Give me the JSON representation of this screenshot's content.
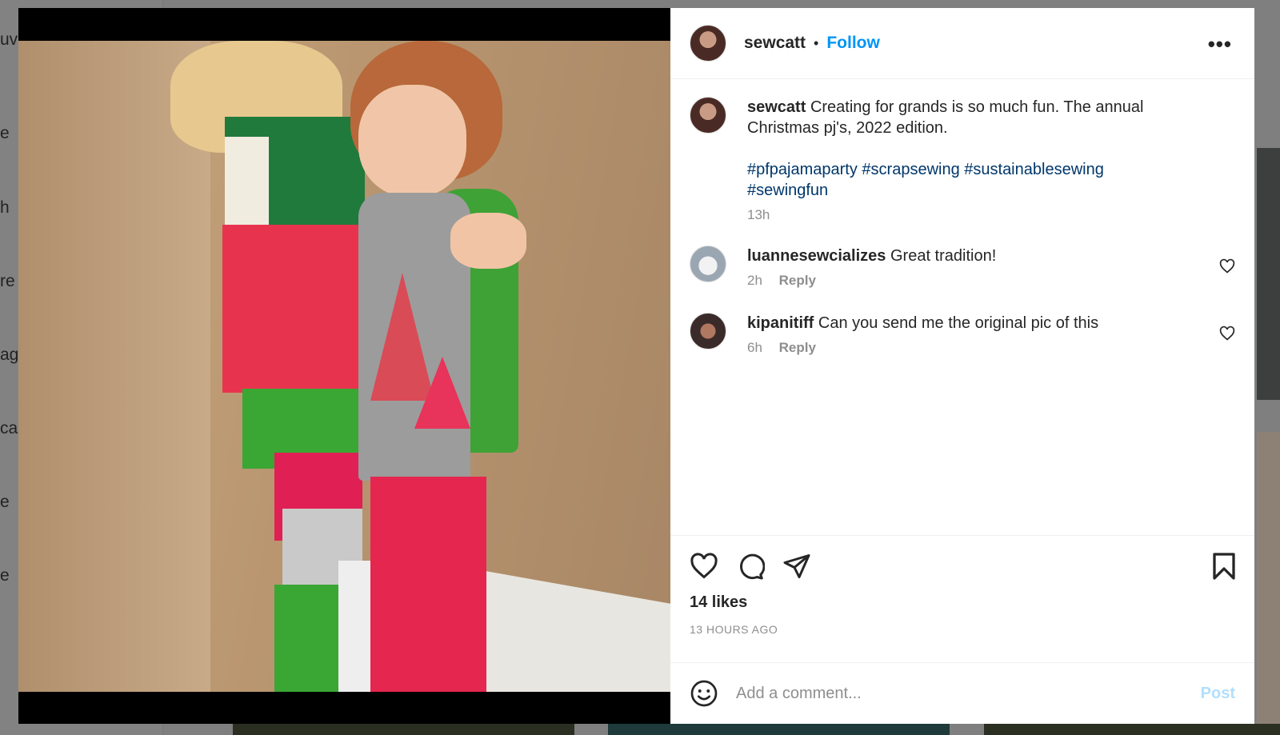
{
  "background": {
    "nav_letters": [
      "uv",
      "e",
      "h",
      "re",
      "ag",
      "ca",
      "e",
      "e"
    ]
  },
  "post": {
    "author": "sewcatt",
    "follow_label": "Follow",
    "more_label": "•••",
    "caption_text": "Creating for grands is so much fun. The annual Christmas pj's, 2022 edition.",
    "hashtags": "#pfpajamaparty #scrapsewing #sustainablesewing #sewingfun",
    "caption_time": "13h"
  },
  "comments": [
    {
      "username": "luannesewcializes",
      "text": "Great tradition!",
      "time": "2h",
      "reply_label": "Reply"
    },
    {
      "username": "kipanitiff",
      "text": "Can you send me the original pic of this",
      "time": "6h",
      "reply_label": "Reply"
    }
  ],
  "actions": {
    "likes": "14 likes",
    "time_ago": "13 HOURS AGO"
  },
  "composer": {
    "placeholder": "Add a comment...",
    "post_label": "Post"
  },
  "colors": {
    "accent": "#0095f6",
    "hashtag": "#00376b",
    "post_disabled": "#b2dffc",
    "muted": "#8e8e8e"
  },
  "icons": [
    "like-icon",
    "comment-icon",
    "share-icon",
    "save-icon",
    "emoji-icon",
    "heart-icon",
    "more-icon"
  ]
}
